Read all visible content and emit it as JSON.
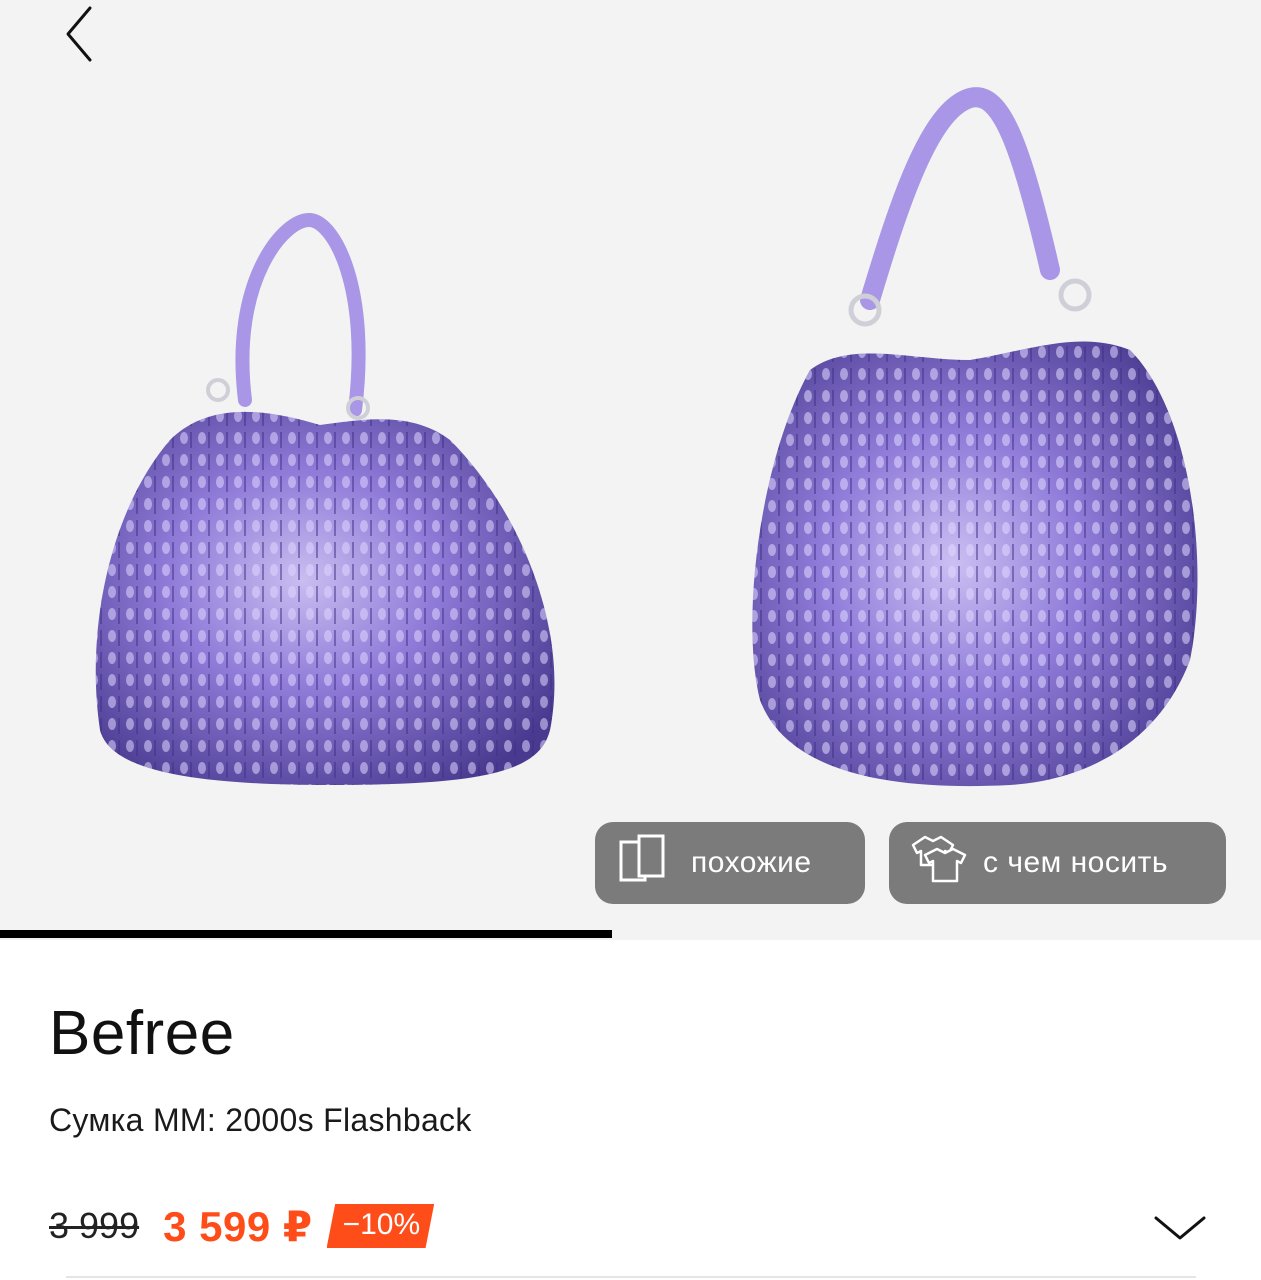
{
  "navigation": {
    "back_icon": "chevron-left-icon"
  },
  "gallery": {
    "images": [
      {
        "alt": "sequin-hobo-bag-front",
        "color": "#8e7ad6"
      },
      {
        "alt": "sequin-hobo-bag-side",
        "color": "#8e7ad6"
      }
    ],
    "progress_fraction": 0.485
  },
  "actions": {
    "similar_label": "похожие",
    "similar_icon": "similar-cards-icon",
    "outfit_label": "с чем носить",
    "outfit_icon": "outfit-clothes-icon"
  },
  "product": {
    "brand": "Befree",
    "name": "Сумка ММ: 2000s Flashback",
    "old_price": "3 999",
    "price": "3 599 ₽",
    "discount": "−10%"
  },
  "colors": {
    "accent": "#ff4d1a",
    "pill_bg": "#7b7b7b",
    "gallery_bg": "#f3f3f3"
  }
}
